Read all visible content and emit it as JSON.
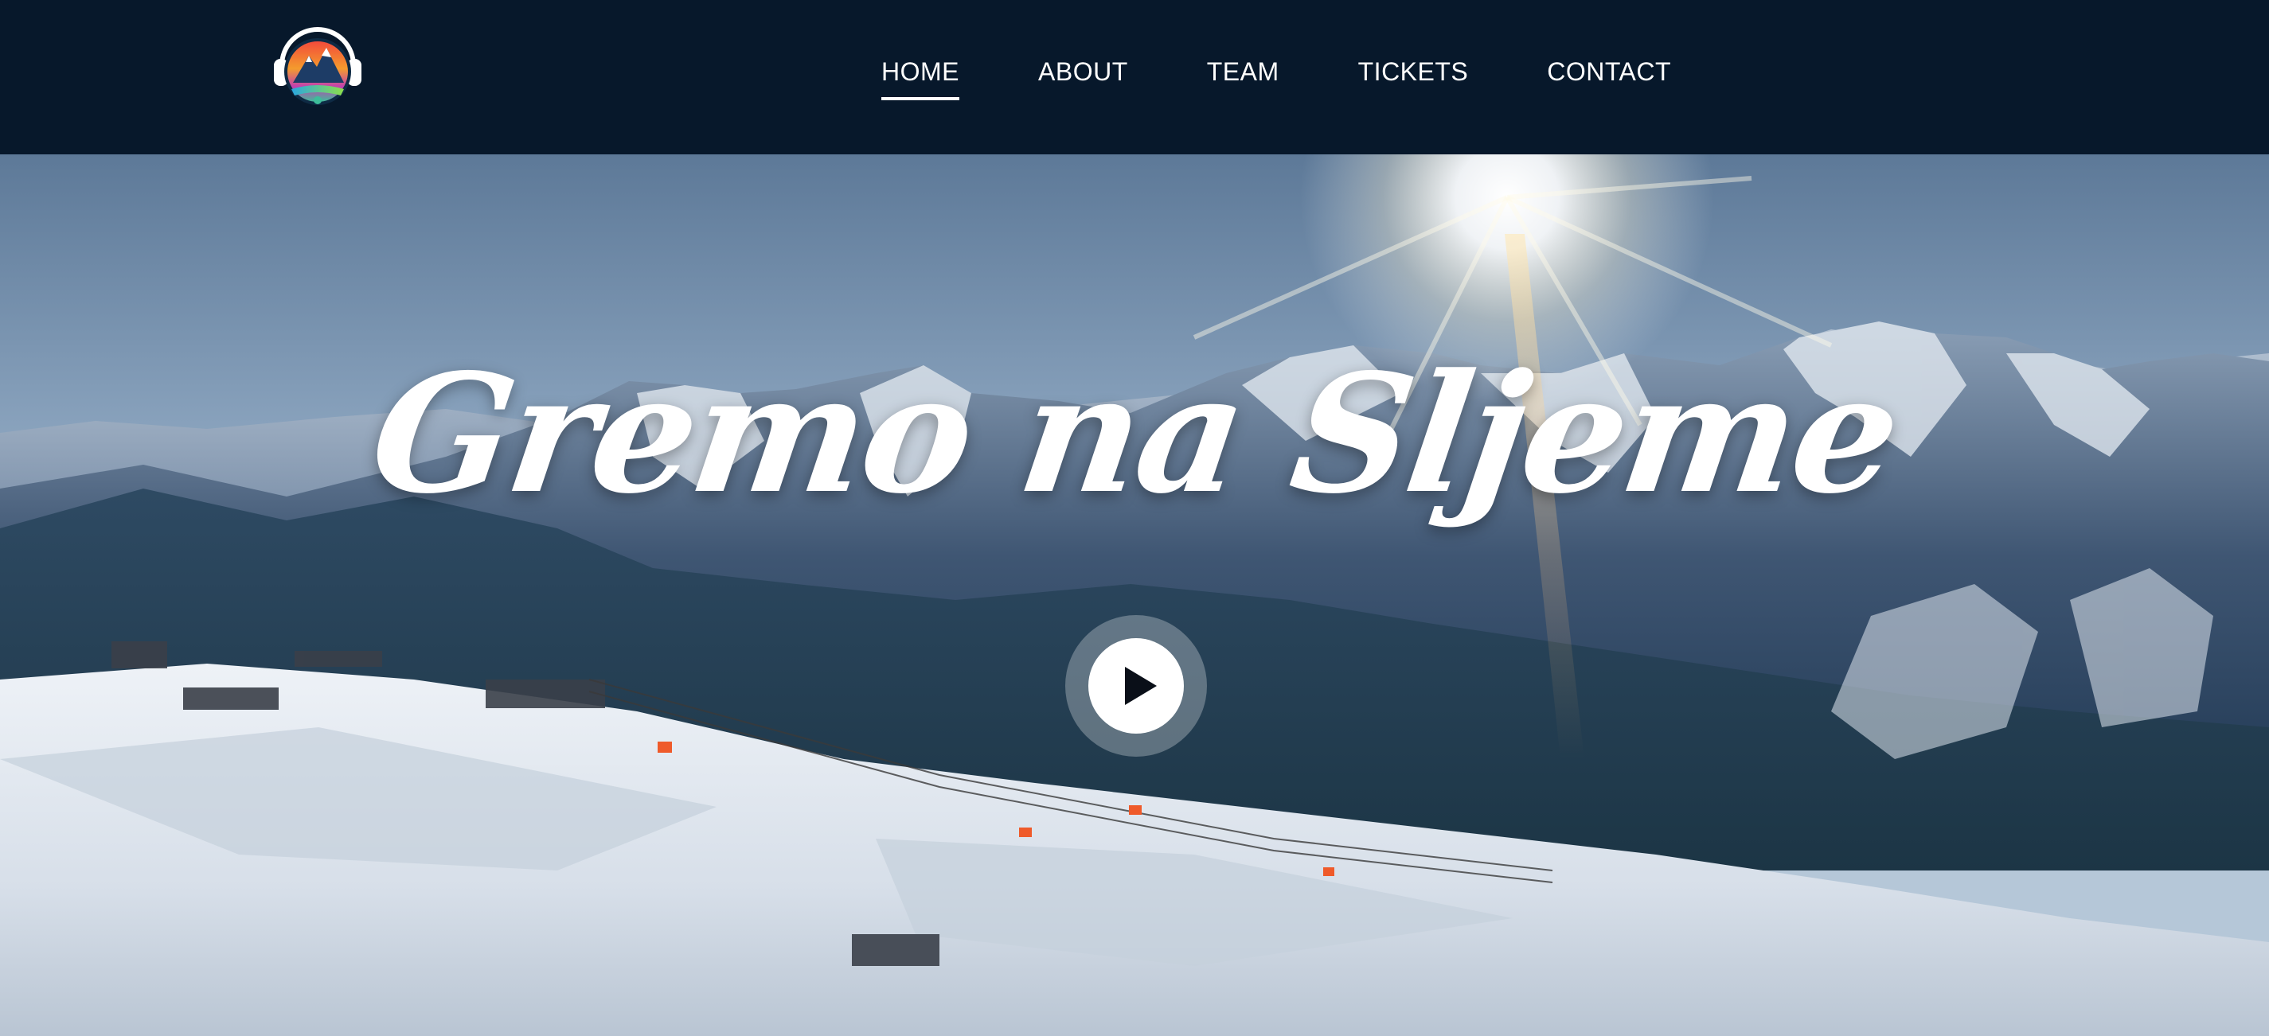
{
  "header": {
    "logo_icon": "mountain-headphones-logo",
    "nav": {
      "items": [
        {
          "label": "HOME",
          "active": true
        },
        {
          "label": "ABOUT",
          "active": false
        },
        {
          "label": "TEAM",
          "active": false
        },
        {
          "label": "TICKETS",
          "active": false
        },
        {
          "label": "CONTACT",
          "active": false
        }
      ]
    }
  },
  "hero": {
    "title": "Gremo na Sljeme",
    "play_icon": "play-icon",
    "background": "snowy-mountain-ski-resort-panorama"
  },
  "colors": {
    "header_bg": "#07182b",
    "nav_text": "#ffffff",
    "active_underline": "#ffffff"
  }
}
